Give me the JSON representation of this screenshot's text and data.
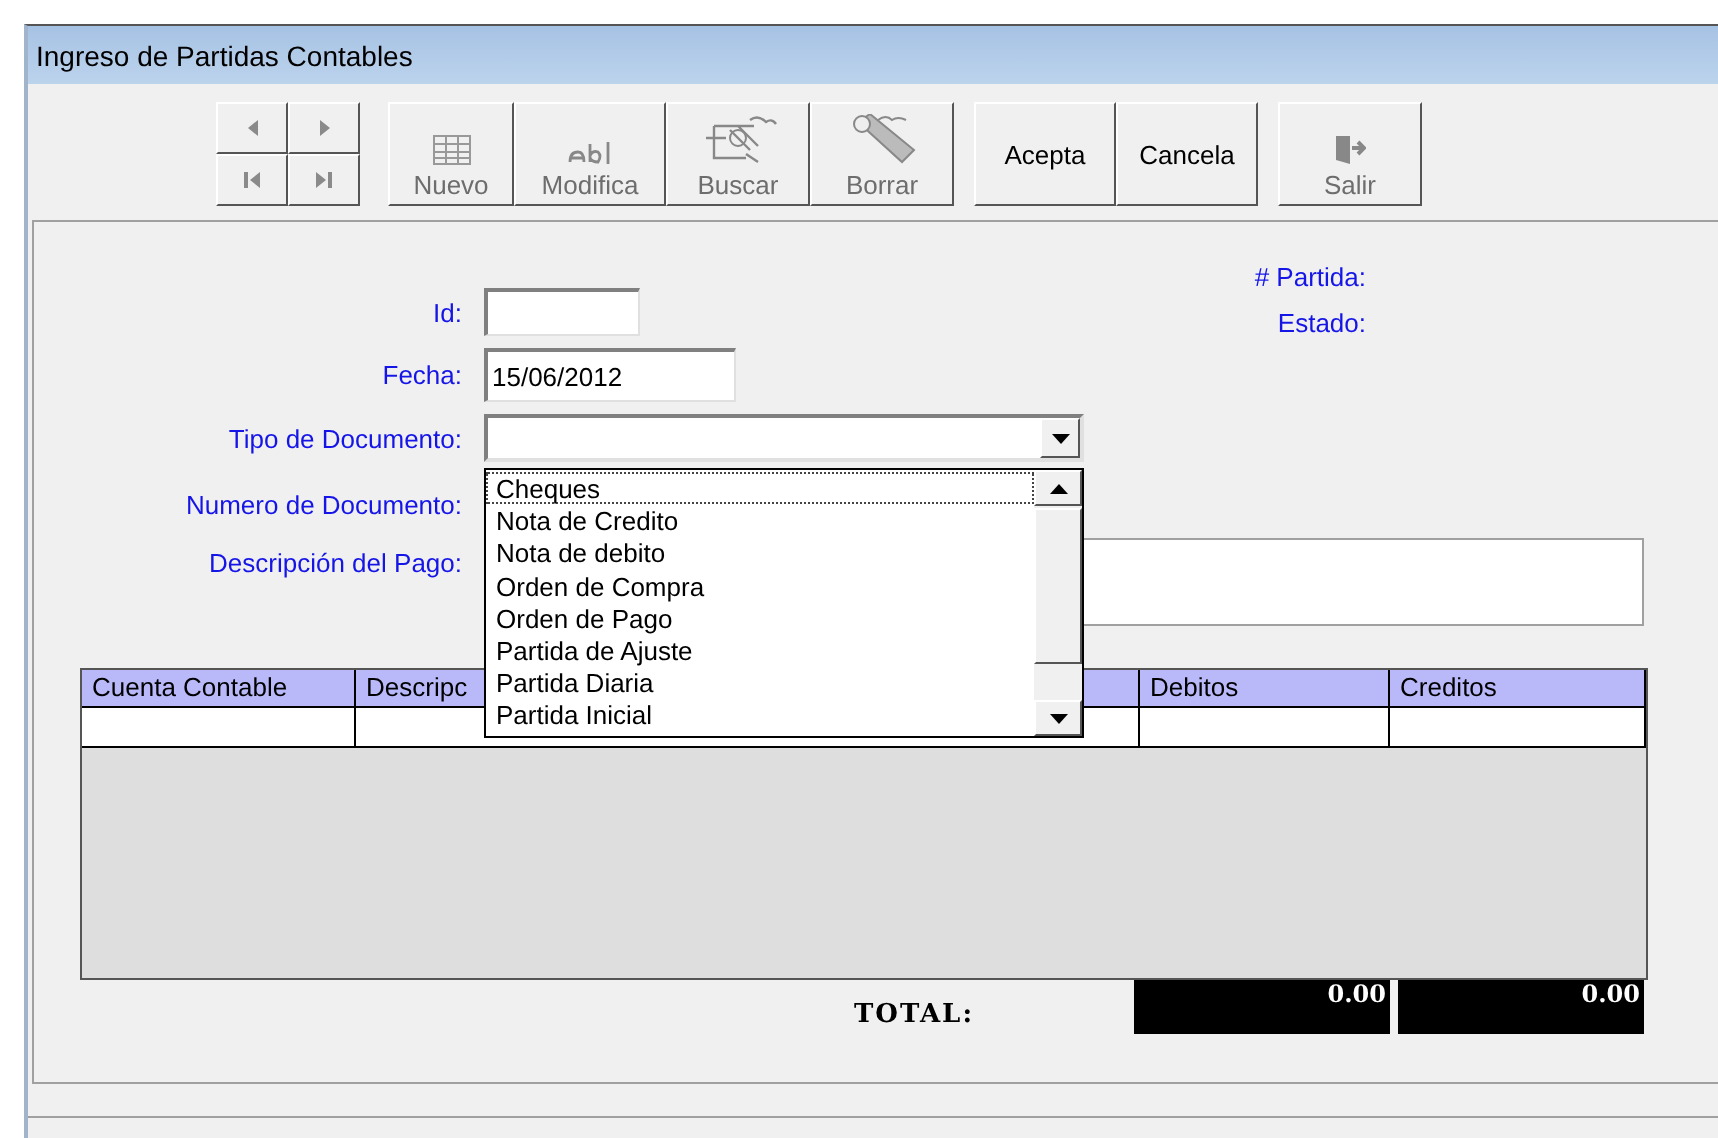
{
  "window": {
    "title": "Ingreso de Partidas Contables"
  },
  "nav_buttons": [
    {
      "kind": "prev",
      "disabled": true
    },
    {
      "kind": "next",
      "disabled": true
    },
    {
      "kind": "first",
      "disabled": true
    },
    {
      "kind": "last",
      "disabled": true
    }
  ],
  "toolbar": [
    {
      "label": "Nuevo",
      "kind": "grid",
      "disabled": true
    },
    {
      "label": "Modifica",
      "kind": "text",
      "disabled": true
    },
    {
      "label": "Buscar",
      "kind": "search",
      "disabled": true
    },
    {
      "label": "Borrar",
      "kind": "eraser",
      "disabled": true
    }
  ],
  "actions": [
    {
      "label": "Acepta",
      "disabled": false
    },
    {
      "label": "Cancela",
      "disabled": false
    }
  ],
  "exit": {
    "label": "Salir",
    "disabled": true
  },
  "form": {
    "id_label": "Id:",
    "fecha_label": "Fecha:",
    "fecha_value": "15/06/2012",
    "tipo_label": "Tipo de Documento:",
    "numero_label": "Numero de Documento:",
    "descripcion_label": "Descripción del Pago:",
    "partida_label": "# Partida:",
    "estado_label": "Estado:"
  },
  "dropdown": {
    "items": [
      {
        "label": "Cheques",
        "selected": true
      },
      {
        "label": "Nota de Credito",
        "selected": false
      },
      {
        "label": "Nota de debito",
        "selected": false
      },
      {
        "label": "Orden de Compra",
        "selected": false
      },
      {
        "label": "Orden de Pago",
        "selected": false
      },
      {
        "label": "Partida de Ajuste",
        "selected": false
      },
      {
        "label": "Partida Diaria",
        "selected": false
      },
      {
        "label": "Partida Inicial",
        "selected": false
      }
    ]
  },
  "table": {
    "columns": [
      "Cuenta Contable",
      "Descripc",
      "Debitos",
      "Creditos"
    ]
  },
  "totals": {
    "label": "TOTAL:",
    "debitos": "0.00",
    "creditos": "0.00"
  }
}
